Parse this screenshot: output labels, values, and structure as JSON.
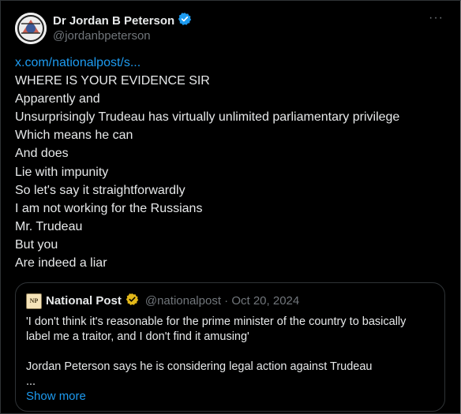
{
  "author": {
    "name": "Dr Jordan B Peterson",
    "handle": "@jordanbpeterson",
    "verified_color": "#1d9bf0"
  },
  "post": {
    "link_text": "x.com/nationalpost/s...",
    "lines": [
      "WHERE IS YOUR EVIDENCE SIR",
      "Apparently and",
      "Unsurprisingly Trudeau has virtually unlimited parliamentary privilege",
      "Which means he can",
      "And does",
      "Lie with impunity",
      "So let's say it straightforwardly",
      "I am not working for the Russians",
      "Mr. Trudeau",
      "But you",
      "Are indeed a liar"
    ]
  },
  "quote": {
    "logo_text": "NP",
    "name": "National Post",
    "handle": "@nationalpost",
    "separator": "·",
    "date": "Oct 20, 2024",
    "verified_color": "#e2b719",
    "paragraph1": "'I don't think it's reasonable for the prime minister of the country to basically label me a traitor, and I don't find it amusing'",
    "paragraph2": "Jordan Peterson says he is considering legal action against Trudeau",
    "ellipsis": "...",
    "show_more": "Show more"
  },
  "icons": {
    "more": "more-options-icon",
    "verified": "verified-badge-icon"
  },
  "colors": {
    "background": "#000000",
    "text": "#e7e9ea",
    "muted": "#71767b",
    "link": "#1d9bf0"
  }
}
